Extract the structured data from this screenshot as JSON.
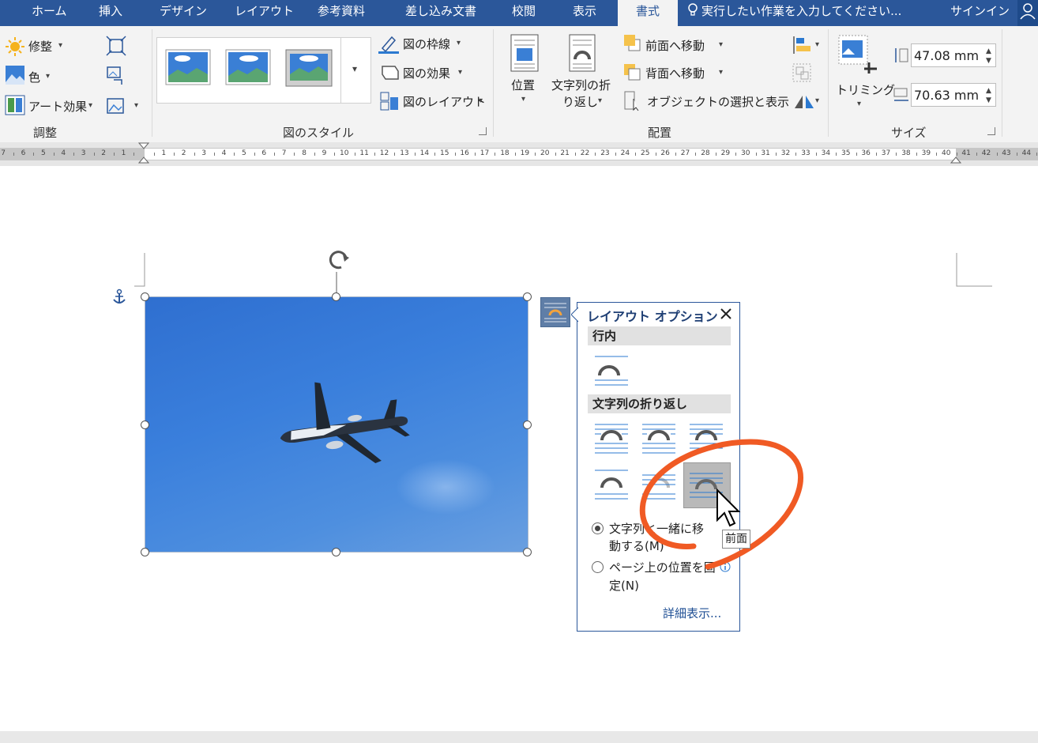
{
  "tabs": [
    "ホーム",
    "挿入",
    "デザイン",
    "レイアウト",
    "参考資料",
    "差し込み文書",
    "校閲",
    "表示",
    "書式"
  ],
  "active_tab": "書式",
  "tell_me": "実行したい作業を入力してください...",
  "signin": "サインイン",
  "ribbon": {
    "adjust": {
      "corrections": "修整",
      "color": "色",
      "artistic": "アート効果",
      "label": "調整"
    },
    "styles": {
      "border": "図の枠線",
      "effects": "図の効果",
      "layout": "図のレイアウト",
      "label": "図のスタイル"
    },
    "arrange": {
      "position": "位置",
      "wrap_line1": "文字列の折",
      "wrap_line2": "り返し",
      "bring_forward": "前面へ移動",
      "send_backward": "背面へ移動",
      "selection_pane": "オブジェクトの選択と表示",
      "label": "配置"
    },
    "size": {
      "crop": "トリミング",
      "height": "47.08 mm",
      "width": "70.63 mm",
      "label": "サイズ"
    }
  },
  "ruler": {
    "left_numbers": [
      "7",
      "6",
      "5",
      "4",
      "3",
      "2",
      "1"
    ],
    "right_numbers": [
      "1",
      "2",
      "3",
      "4",
      "5",
      "6",
      "7",
      "8",
      "9",
      "10",
      "11",
      "12",
      "13",
      "14",
      "15",
      "16",
      "17",
      "18",
      "19",
      "20",
      "21",
      "22",
      "23",
      "24",
      "25",
      "26",
      "27",
      "28",
      "29",
      "30",
      "31",
      "32",
      "33",
      "34",
      "35",
      "36",
      "37",
      "38",
      "39",
      "40",
      "41",
      "42",
      "43",
      "44"
    ]
  },
  "layout_panel": {
    "title": "レイアウト オプション",
    "inline_header": "行内",
    "wrap_header": "文字列の折り返し",
    "move_with_text_1": "文字列と一緒に移",
    "move_with_text_2": "動する(M)",
    "fix_position_1": "ページ上の位置を固",
    "fix_position_2": "定(N)",
    "more": "詳細表示...",
    "tooltip": "前面"
  },
  "colors": {
    "accent": "#2b579a",
    "annotation": "#f05a24"
  }
}
